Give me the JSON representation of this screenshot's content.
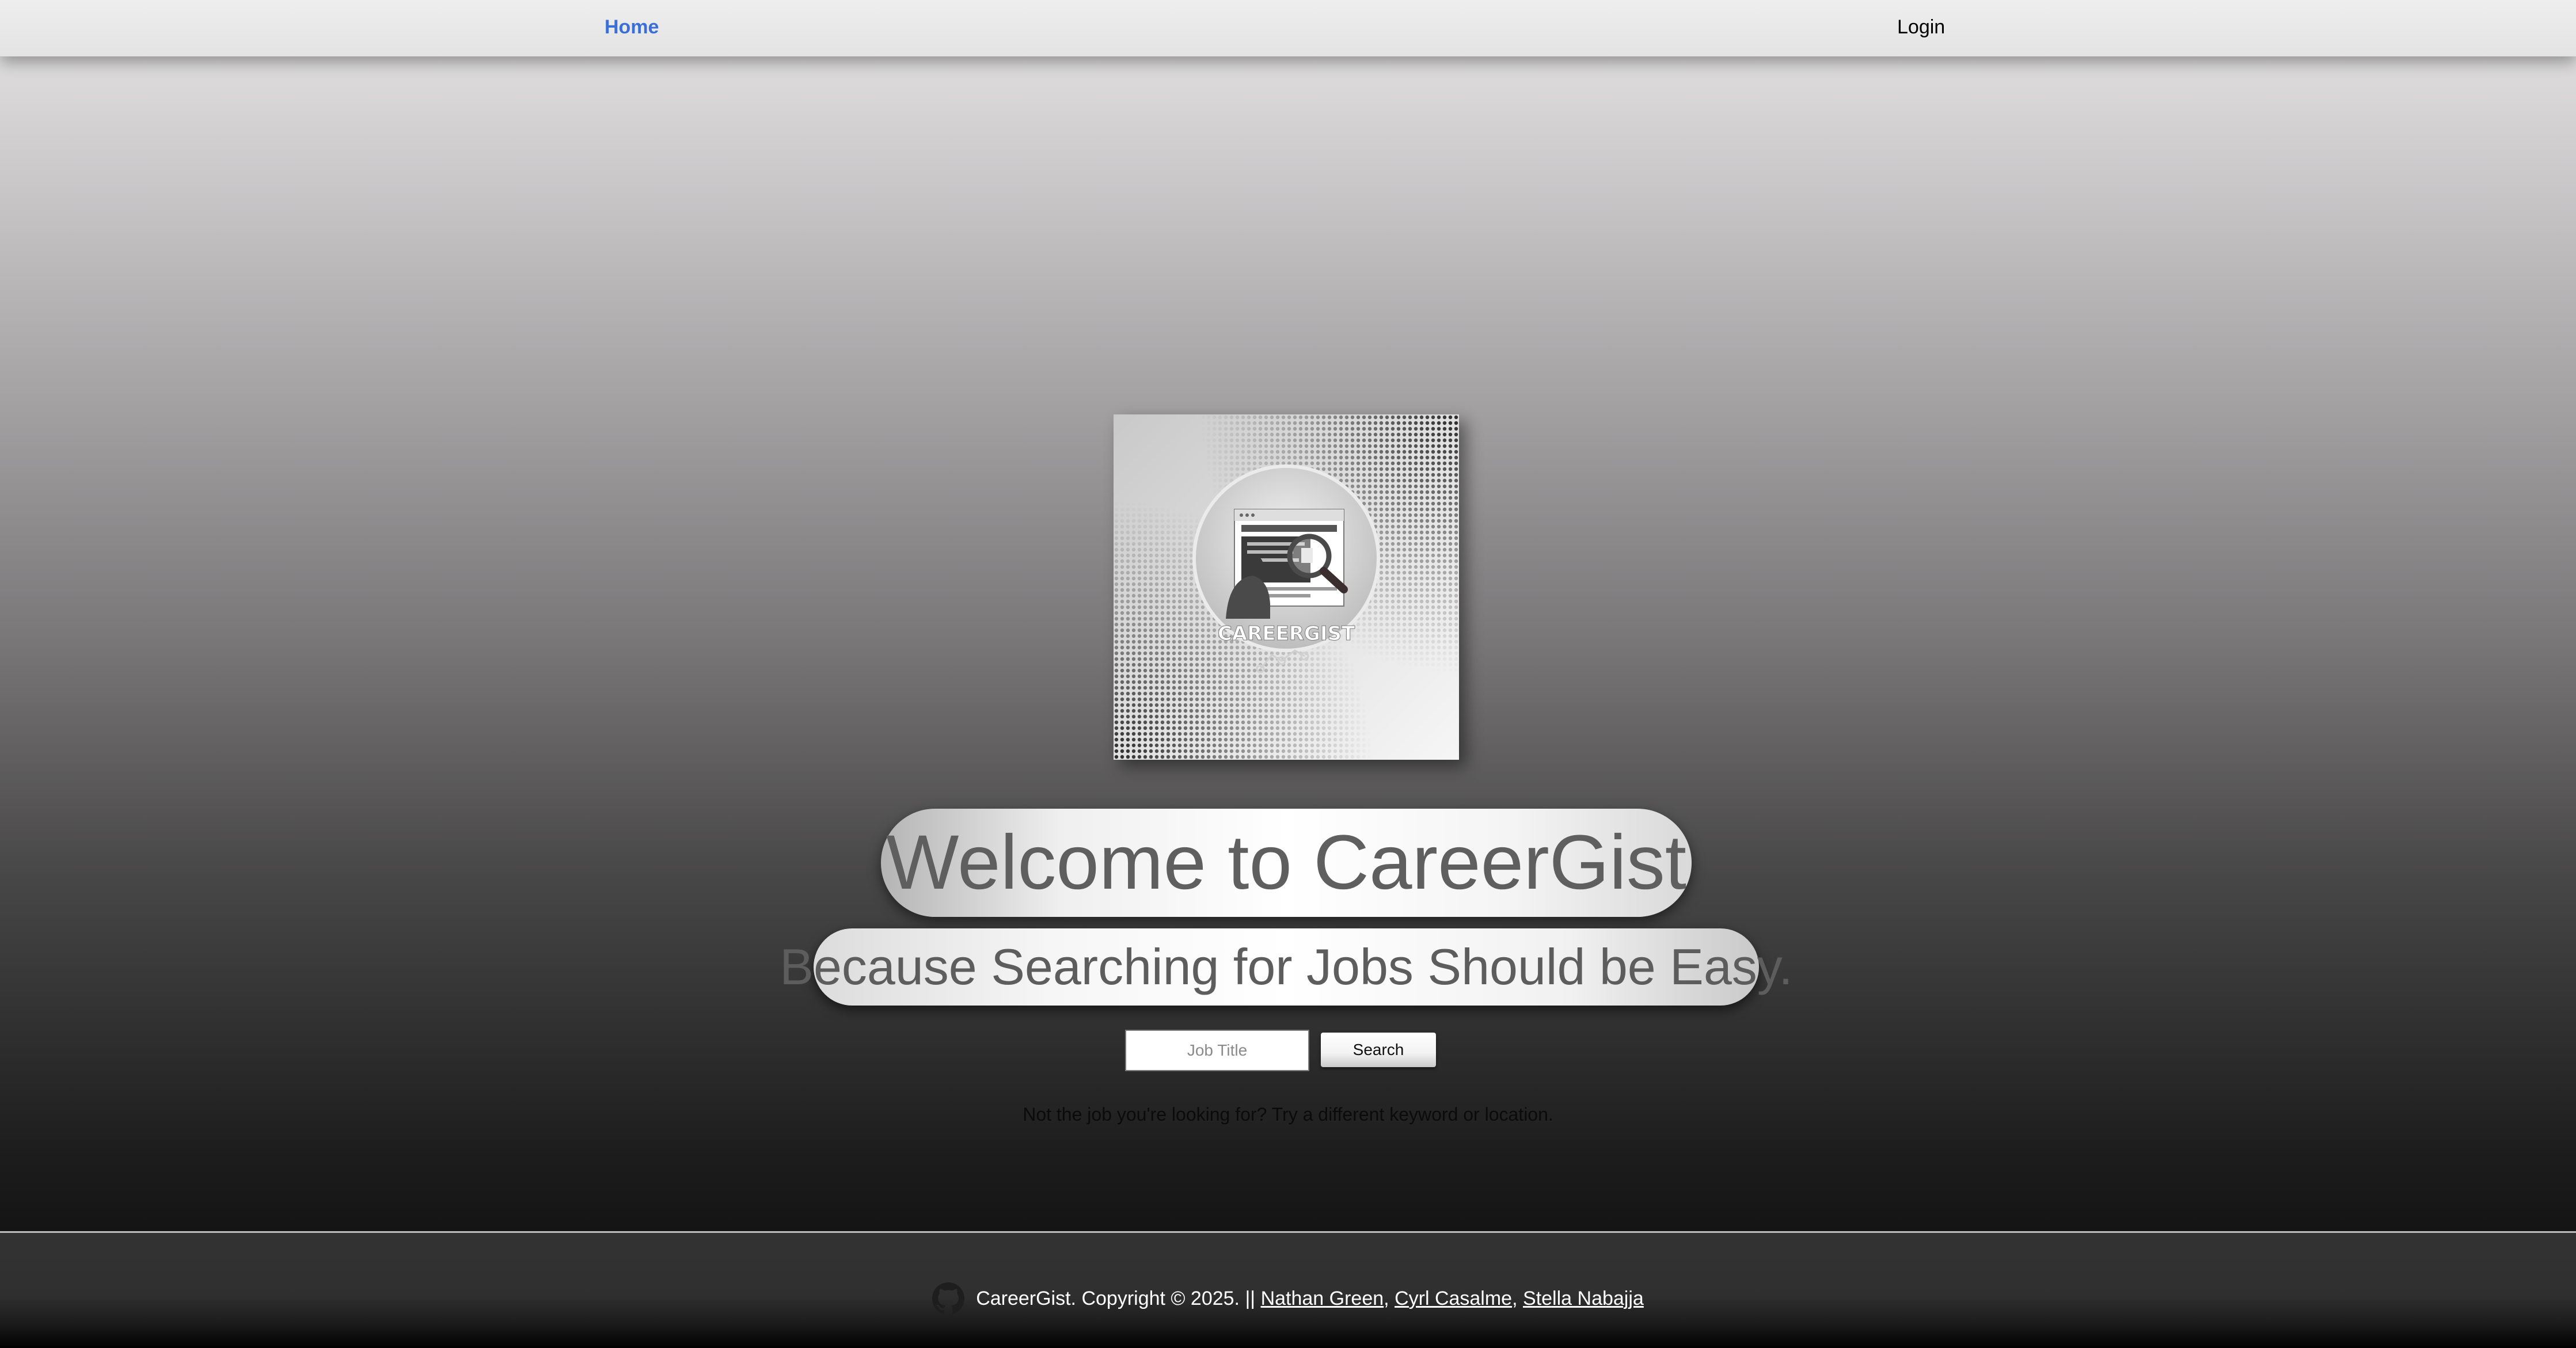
{
  "nav": {
    "home_label": "Home",
    "login_label": "Login"
  },
  "logo": {
    "brand_text": "CAREERGIST"
  },
  "hero": {
    "welcome": "Welcome to CareerGist",
    "tagline": "Because Searching for Jobs Should be Easy."
  },
  "search": {
    "placeholder": "Job Title",
    "value": "",
    "button_label": "Search"
  },
  "hint": "Not the job you're looking for? Try a different keyword or location.",
  "footer": {
    "copyright": "CareerGist. Copyright © 2025. ||",
    "authors": [
      {
        "name": "Nathan Green"
      },
      {
        "name": "Cyrl Casalme"
      },
      {
        "name": "Stella Nabajja"
      }
    ],
    "separator": ", ",
    "icon": "github-icon"
  },
  "colors": {
    "nav_active": "#3a6fd8",
    "heading_text": "#5f5f5f",
    "footer_bg": "#333333"
  }
}
